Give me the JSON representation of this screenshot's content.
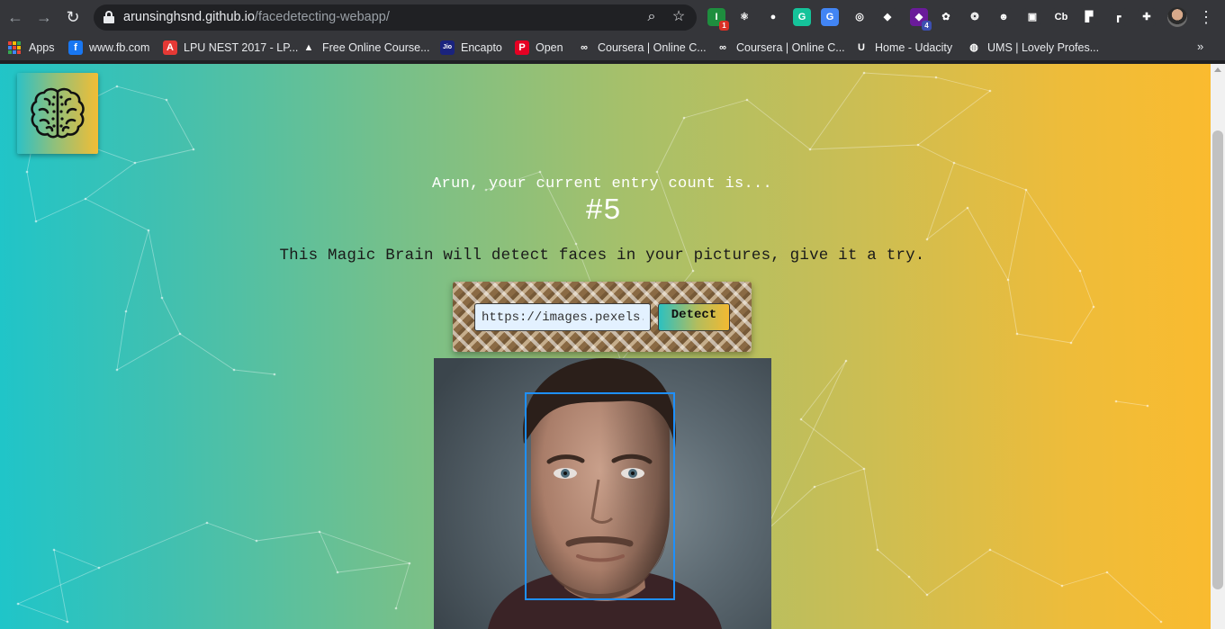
{
  "browser": {
    "url_host": "arunsinghsnd.github.io",
    "url_path": "/facedetecting-webapp/",
    "extensions": [
      {
        "name": "extension-1-icon",
        "color": "#1e8e3e",
        "glyph": "I",
        "badge": "1",
        "badge_color": "#d93025"
      },
      {
        "name": "react-devtools-icon",
        "color": "#35363a",
        "glyph": "⚛",
        "badge": "",
        "badge_color": ""
      },
      {
        "name": "extension-3-icon",
        "color": "#35363a",
        "glyph": "●",
        "badge": "",
        "badge_color": ""
      },
      {
        "name": "grammarly-icon",
        "color": "#15c39a",
        "glyph": "G",
        "badge": "",
        "badge_color": ""
      },
      {
        "name": "google-translate-icon",
        "color": "#4285f4",
        "glyph": "G",
        "badge": "",
        "badge_color": ""
      },
      {
        "name": "extension-6-icon",
        "color": "#35363a",
        "glyph": "◎",
        "badge": "",
        "badge_color": ""
      },
      {
        "name": "extension-7-icon",
        "color": "#35363a",
        "glyph": "◆",
        "badge": "",
        "badge_color": ""
      },
      {
        "name": "extension-8-icon",
        "color": "#6a1b9a",
        "glyph": "◆",
        "badge": "4",
        "badge_color": "#3c4fb0"
      },
      {
        "name": "color-picker-icon",
        "color": "#35363a",
        "glyph": "✿",
        "badge": "",
        "badge_color": ""
      },
      {
        "name": "extension-10-icon",
        "color": "#35363a",
        "glyph": "❂",
        "badge": "",
        "badge_color": ""
      },
      {
        "name": "extension-11-icon",
        "color": "#35363a",
        "glyph": "☻",
        "badge": "",
        "badge_color": ""
      },
      {
        "name": "screenshot-icon",
        "color": "#35363a",
        "glyph": "▣",
        "badge": "",
        "badge_color": ""
      },
      {
        "name": "extension-cb-icon",
        "color": "#35363a",
        "glyph": "Cb",
        "badge": "",
        "badge_color": ""
      },
      {
        "name": "extension-14-icon",
        "color": "#35363a",
        "glyph": "▛",
        "badge": "",
        "badge_color": ""
      },
      {
        "name": "extension-15-icon",
        "color": "#35363a",
        "glyph": "┏",
        "badge": "",
        "badge_color": ""
      },
      {
        "name": "extensions-puzzle-icon",
        "color": "#35363a",
        "glyph": "✚",
        "badge": "",
        "badge_color": ""
      }
    ],
    "bookmarks": [
      {
        "label": "Apps",
        "icon": "apps-grid-icon",
        "color": ""
      },
      {
        "label": "www.fb.com",
        "icon": "facebook-icon",
        "color": "#1877f2",
        "glyph": "f"
      },
      {
        "label": "LPU NEST 2017 - LP...",
        "icon": "lpu-nest-icon",
        "color": "#e53935",
        "glyph": "A"
      },
      {
        "label": "Free Online Course...",
        "icon": "free-course-icon",
        "color": "#35363a",
        "glyph": "▲"
      },
      {
        "label": "Encapto",
        "icon": "jio-icon",
        "color": "#1a237e",
        "glyph": "Jio"
      },
      {
        "label": "Open",
        "icon": "pinterest-icon",
        "color": "#e60023",
        "glyph": "P"
      },
      {
        "label": "Coursera | Online C...",
        "icon": "coursera-icon",
        "color": "#35363a",
        "glyph": "∞"
      },
      {
        "label": "Coursera | Online C...",
        "icon": "coursera-icon",
        "color": "#35363a",
        "glyph": "∞"
      },
      {
        "label": "Home - Udacity",
        "icon": "udacity-icon",
        "color": "#35363a",
        "glyph": "U"
      },
      {
        "label": "UMS | Lovely Profes...",
        "icon": "globe-icon",
        "color": "#35363a",
        "glyph": "◍"
      }
    ],
    "more_bookmarks": "»"
  },
  "page": {
    "entry_text": "Arun, your current entry count is...",
    "entry_count": "#5",
    "tagline": "This Magic Brain will detect faces in your pictures, give it a try.",
    "input_value": "https://images.pexels.com/photos/",
    "detect_label": "Detect"
  },
  "colors": {
    "gradient_start": "#1fc5c9",
    "gradient_end": "#fabb2f",
    "face_box": "#1e90ff"
  }
}
